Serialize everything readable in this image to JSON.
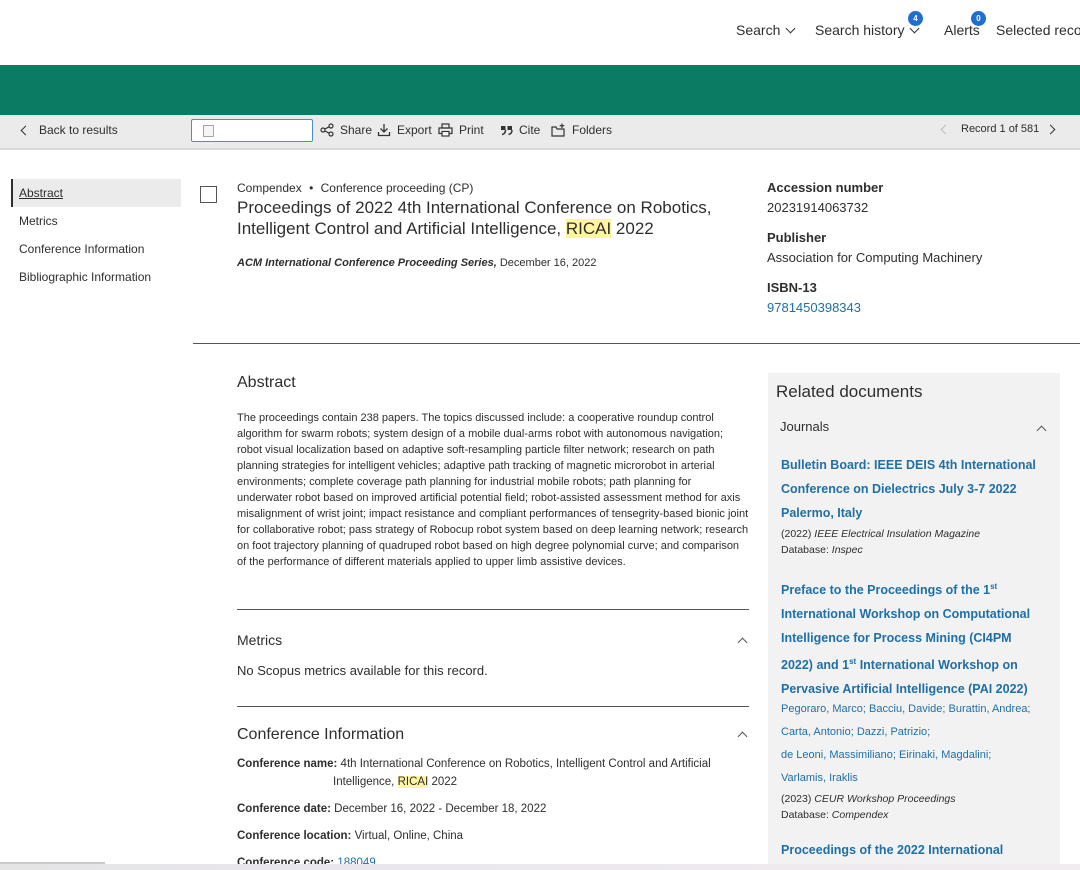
{
  "topnav": {
    "search": "Search",
    "search_history": "Search history",
    "search_history_badge": "4",
    "alerts": "Alerts",
    "alerts_badge": "0",
    "selected_records": "Selected recor"
  },
  "toolbar": {
    "back": "Back to results",
    "share": "Share",
    "export": "Export",
    "print": "Print",
    "cite": "Cite",
    "folders": "Folders",
    "record": "Record 1 of 581"
  },
  "sidenav": {
    "items": [
      "Abstract",
      "Metrics",
      "Conference Information",
      "Bibliographic Information"
    ]
  },
  "record": {
    "database": "Compendex",
    "bullet": "•",
    "doc_type": "Conference proceeding (CP)",
    "title_part1": "Proceedings of 2022 4th International Conference on Robotics, Intelligent Control and Artificial Intelligence, ",
    "title_highlight": "RICAI",
    "title_part2": " 2022",
    "series": "ACM International Conference Proceeding Series,",
    "date": " December 16, 2022"
  },
  "details": {
    "accession_label": "Accession number",
    "accession_value": "20231914063732",
    "publisher_label": "Publisher",
    "publisher_value": "Association for Computing Machinery",
    "isbn_label": "ISBN-13",
    "isbn_value": "9781450398343"
  },
  "abstract": {
    "heading": "Abstract",
    "text": "The proceedings contain 238 papers. The topics discussed include: a cooperative roundup control algorithm for swarm robots; system design of a mobile dual-arms robot with autonomous navigation; robot visual localization based on adaptive soft-resampling particle filter network; research on path planning strategies for intelligent vehicles; adaptive path tracking of magnetic microrobot in arterial environments; complete coverage path planning for industrial mobile robots; path planning for underwater robot based on improved artificial potential field; robot-assisted assessment method for axis misalignment of wrist joint; impact resistance and compliant performances of tensegrity-based bionic joint for collaborative robot; pass strategy of Robocup robot system based on deep learning network; research on foot trajectory planning of quadruped robot based on high degree polynomial curve; and comparison of the performance of different materials applied to upper limb assistive devices."
  },
  "metrics": {
    "heading": "Metrics",
    "text": "No Scopus metrics available for this record."
  },
  "conference": {
    "heading": "Conference Information",
    "name_label": "Conference name:",
    "name_value_1": "4th International Conference on Robotics, Intelligent Control and Artificial",
    "name_value_2a": "Intelligence, ",
    "name_value_2_hl": "RICAI",
    "name_value_2b": " 2022",
    "date_label": "Conference date:",
    "date_value": "December 16, 2022 - December 18, 2022",
    "location_label": "Conference location:",
    "location_value": "Virtual, Online, China",
    "code_label": "Conference code:",
    "code_value": "188049"
  },
  "related": {
    "heading": "Related documents",
    "journals_label": "Journals",
    "doc1": {
      "title": "Bulletin Board: IEEE DEIS 4th International Conference on Dielectrics July 3-7 2022 Palermo, Italy",
      "year": "(2022) ",
      "source": "IEEE Electrical Insulation Magazine",
      "db_label": "Database: ",
      "db": "Inspec"
    },
    "doc2": {
      "t1": "Preface to the Proceedings of the 1",
      "sup1": "st",
      "t2": " International Workshop on Computational Intelligence for Process Mining (CI4PM 2022) and 1",
      "sup2": "st",
      "t3": " International Workshop on Pervasive Artificial Intelligence (PAI 2022)",
      "authors": [
        "Pegoraro, Marco;",
        "Bacciu, Davide;",
        "Burattin, Andrea;",
        "Carta, Antonio;",
        "Dazzi, Patrizio;",
        "de Leoni, Massimiliano;",
        "Eirinaki, Magdalini;",
        "Varlamis, Iraklis"
      ],
      "year": "(2023) ",
      "source": "CEUR Workshop Proceedings",
      "db_label": "Database: ",
      "db": "Compendex"
    },
    "doc3": {
      "title": "Proceedings of the 2022 International"
    }
  }
}
